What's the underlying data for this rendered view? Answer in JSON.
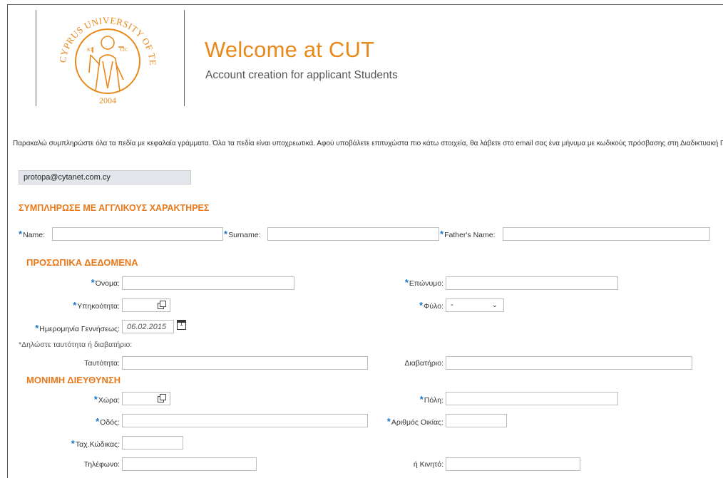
{
  "header": {
    "logo_text_top": "CYPRUS UNIVERSITY OF TECHNOLOGY",
    "logo_year": "2004",
    "title": "Welcome at CUT",
    "subtitle": "Account creation for applicant Students"
  },
  "instructions": "Παρακαλώ συμπληρώστε όλα τα πεδία με κεφαλαία γράμματα.  Όλα τα πεδία είναι υποχρεωτικά.  Αφού υποβάλετε επιτυχώστα πιο κάτω στοιχεία, θα λάβετε στο email σας ένα μήνυμα με κωδικούς πρόσβασης στη Διαδικτυακή Πύλη.",
  "email_value": "protopa@cytanet.com.cy",
  "sections": {
    "english": "ΣΥΜΠΛΗΡΩΣΕ ΜΕ ΑΓΓΛΙΚΟΥΣ ΧΑΡΑΚΤΗΡΕΣ",
    "personal": "ΠΡΟΣΩΠΙΚΑ ΔΕΔΟΜΕΝΑ",
    "address": "ΜΟΝΙΜΗ ΔΙΕΥΘΥΝΣΗ"
  },
  "required_mark": "*",
  "labels": {
    "name": "Name:",
    "surname": "Surname:",
    "fathers_name": "Father's Name:",
    "onoma": "Όνομα:",
    "eponymo": "Επώνυμο:",
    "ypikootita": "Υπηκοότητα:",
    "fylo": "Φύλο:",
    "birthdate": "Ημερομηνία Γεννήσεως:",
    "id_note": "*Δηλώστε ταυτότητα ή διαβατήριο:",
    "tautotita": "Ταυτότητα:",
    "diavatirio": "Διαβατήριο:",
    "xora": "Χώρα:",
    "poli": "Πόλη:",
    "odos": "Οδός:",
    "arithmos": "Αριθμός Οικίας:",
    "tk": "Ταχ.Κώδικας:",
    "tilefono": "Τηλέφωνο:",
    "kinito": "ή Κινητό:"
  },
  "values": {
    "fylo_selected": "-",
    "birthdate": "06.02.2015"
  },
  "icons": {
    "value_help": "value-help-icon",
    "calendar": "calendar-icon",
    "dropdown": "chevron-down-icon"
  },
  "colors": {
    "brand_orange": "#e8891a",
    "required_blue": "#1a75c9"
  }
}
